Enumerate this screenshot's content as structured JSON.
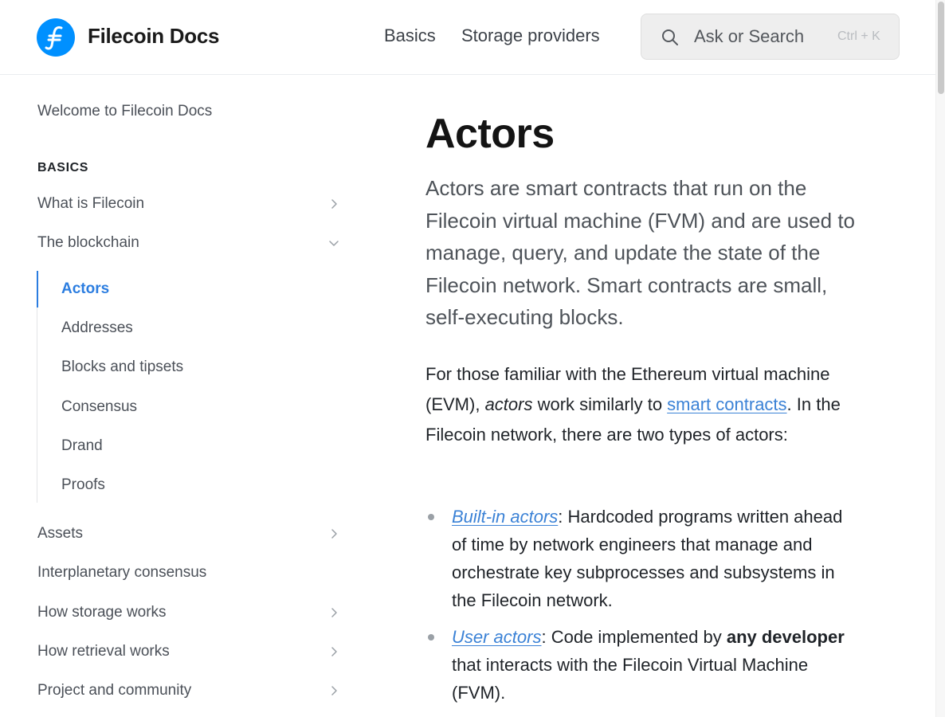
{
  "header": {
    "brand": "Filecoin Docs",
    "nav": [
      "Basics",
      "Storage providers"
    ],
    "search": {
      "placeholder": "Ask or Search",
      "shortcut": "Ctrl + K"
    }
  },
  "sidebar": {
    "welcome": "Welcome to Filecoin Docs",
    "section_heading": "BASICS",
    "items": [
      {
        "label": "What is Filecoin",
        "icon": "chevron-right-icon"
      },
      {
        "label": "The blockchain",
        "icon": "chevron-down-icon",
        "expanded": true
      },
      {
        "label": "Assets",
        "icon": "chevron-right-icon"
      },
      {
        "label": "Interplanetary consensus"
      },
      {
        "label": "How storage works",
        "icon": "chevron-right-icon"
      },
      {
        "label": "How retrieval works",
        "icon": "chevron-right-icon"
      },
      {
        "label": "Project and community",
        "icon": "chevron-right-icon"
      }
    ],
    "blockchain_children": [
      "Actors",
      "Addresses",
      "Blocks and tipsets",
      "Consensus",
      "Drand",
      "Proofs"
    ],
    "active_item": "Actors"
  },
  "main": {
    "title": "Actors",
    "lead": "Actors are smart contracts that run on the Filecoin virtual machine (FVM) and are used to manage, query, and update the state of the Filecoin network. Smart contracts are small, self-executing blocks.",
    "para": {
      "text1": "For those familiar with the Ethereum virtual machine (EVM), ",
      "em": "actors",
      "text2": " work similarly to ",
      "link": "smart contracts",
      "text3": ". In the Filecoin network, there are two types of actors:"
    },
    "list": [
      {
        "link": "Built-in actors",
        "text": ": Hardcoded programs written ahead of time by network engineers that manage and orchestrate key subprocesses and subsystems in the Filecoin network."
      },
      {
        "link": "User actors",
        "text1": ": Code implemented by ",
        "bold": "any developer",
        "text2": " that interacts with the Filecoin Virtual Machine (FVM)."
      }
    ]
  },
  "colors": {
    "accent": "#2b7de0",
    "logo": "#0090ff",
    "link": "#3b82d6"
  }
}
